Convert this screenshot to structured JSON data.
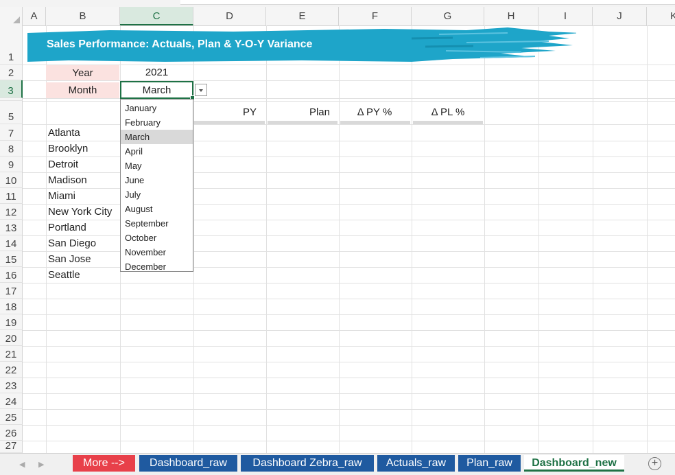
{
  "columns": [
    "A",
    "B",
    "C",
    "D",
    "E",
    "F",
    "G",
    "H",
    "I",
    "J",
    "K"
  ],
  "selected_column": "C",
  "rows": [
    "1",
    "2",
    "3",
    "5",
    "7",
    "8",
    "9",
    "10",
    "11",
    "12",
    "13",
    "14",
    "15",
    "16",
    "17",
    "18",
    "19",
    "20",
    "21",
    "22",
    "23",
    "24",
    "25",
    "26",
    "27"
  ],
  "selected_row": "3",
  "banner": {
    "title": "Sales Performance: Actuals, Plan & Y-O-Y Variance",
    "color": "#1ea5c9"
  },
  "params": {
    "year_label": "Year",
    "year_value": "2021",
    "month_label": "Month",
    "month_value": "March"
  },
  "table": {
    "headers": [
      "PY",
      "Plan",
      "Δ PY %",
      "Δ PL %"
    ],
    "cities": [
      "Atlanta",
      "Brooklyn",
      "Detroit",
      "Madison",
      "Miami",
      "New York City",
      "Portland",
      "San Diego",
      "San Jose",
      "Seattle"
    ]
  },
  "dropdown": {
    "options": [
      "January",
      "February",
      "March",
      "April",
      "May",
      "June",
      "July",
      "August",
      "September",
      "October",
      "November",
      "December"
    ],
    "highlighted": "March"
  },
  "tabs": [
    {
      "label": "More -->",
      "color": "#e8404a"
    },
    {
      "label": "Dashboard_raw",
      "color": "#1f5aa0"
    },
    {
      "label": "Dashboard Zebra_raw",
      "color": "#1f5aa0"
    },
    {
      "label": "Actuals_raw",
      "color": "#1f5aa0"
    },
    {
      "label": "Plan_raw",
      "color": "#1f5aa0"
    },
    {
      "label": "Dashboard_new",
      "color": "#ffffff",
      "active": true
    }
  ],
  "nav": {
    "prev": "◀",
    "next": "▶",
    "add_sheet": "+"
  }
}
